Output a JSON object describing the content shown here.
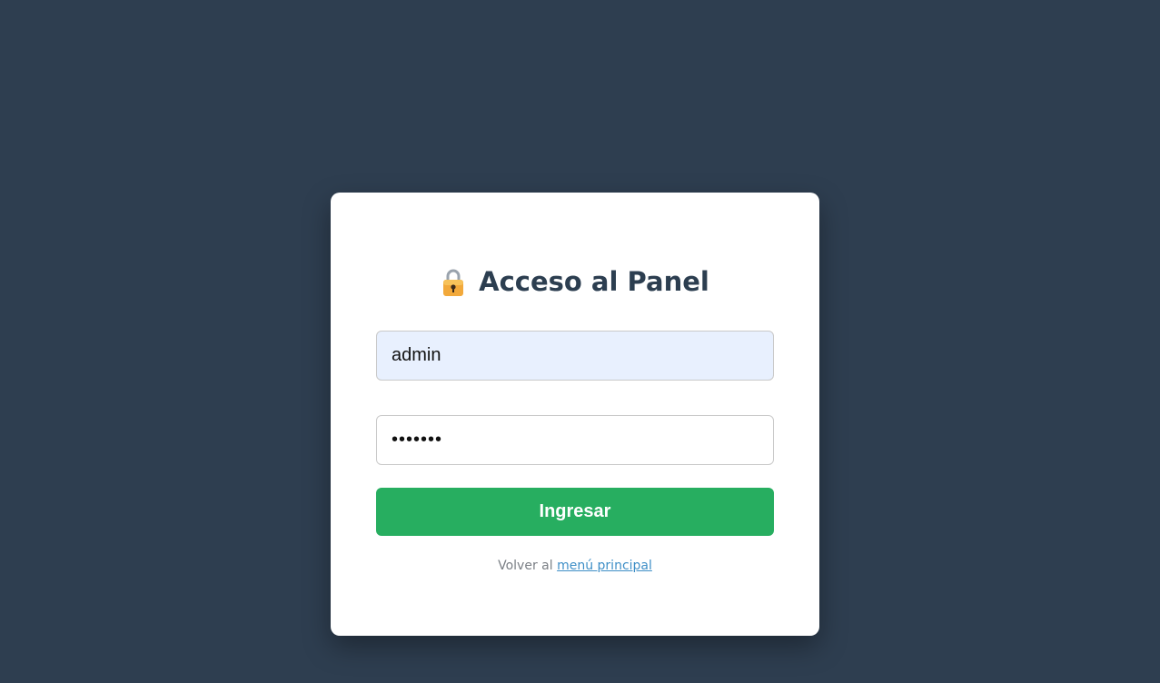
{
  "login": {
    "title": "Acceso al Panel",
    "username_value": "admin",
    "password_value": "•••••••",
    "submit_label": "Ingresar",
    "footer_prefix": "Volver al",
    "footer_link": "menú principal"
  },
  "colors": {
    "background": "#2e3e50",
    "accent": "#27ae60",
    "link": "#3f8fc7"
  },
  "icons": {
    "title_icon": "lock-icon"
  }
}
